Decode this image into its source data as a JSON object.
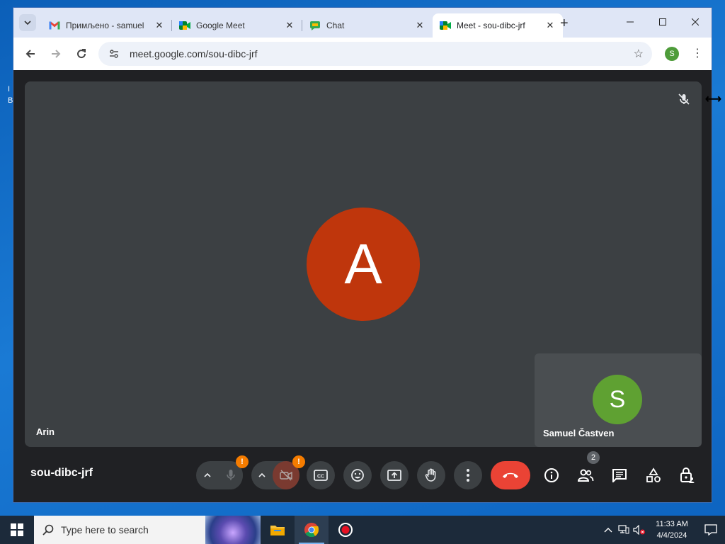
{
  "browser": {
    "tabs": [
      {
        "title": "Примљено - samuel",
        "icon": "gmail-icon",
        "active": false
      },
      {
        "title": "Google Meet",
        "icon": "meet-icon",
        "active": false
      },
      {
        "title": "Chat",
        "icon": "chat-icon",
        "active": false
      },
      {
        "title": "Meet - sou-dibc-jrf",
        "icon": "meet-icon",
        "active": true
      }
    ],
    "url": "meet.google.com/sou-dibc-jrf",
    "profile_initial": "S"
  },
  "meet": {
    "main_participant": {
      "name": "Arin",
      "initial": "A",
      "color": "#bf360c"
    },
    "self_participant": {
      "name": "Samuel Častven",
      "initial": "S",
      "color": "#5fa132"
    },
    "meeting_code": "sou-dibc-jrf",
    "people_count": "2",
    "warning_badge": "!"
  },
  "taskbar": {
    "search_placeholder": "Type here to search",
    "time": "11:33 AM",
    "date": "4/4/2024"
  },
  "desktop": {
    "edge_text": "I\nB"
  }
}
